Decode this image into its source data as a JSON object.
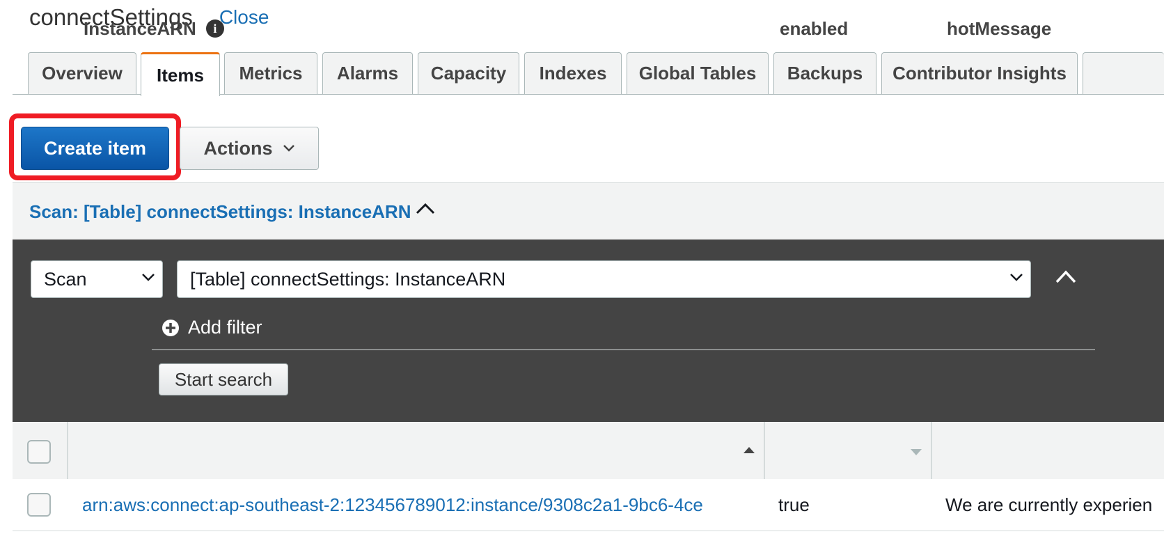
{
  "header": {
    "title": "connectSettings",
    "close_label": "Close"
  },
  "tabs": [
    {
      "label": "Overview",
      "active": false
    },
    {
      "label": "Items",
      "active": true
    },
    {
      "label": "Metrics",
      "active": false
    },
    {
      "label": "Alarms",
      "active": false
    },
    {
      "label": "Capacity",
      "active": false
    },
    {
      "label": "Indexes",
      "active": false
    },
    {
      "label": "Global Tables",
      "active": false
    },
    {
      "label": "Backups",
      "active": false
    },
    {
      "label": "Contributor Insights",
      "active": false
    }
  ],
  "toolbar": {
    "create_label": "Create item",
    "actions_label": "Actions"
  },
  "scan": {
    "title": "Scan: [Table] connectSettings: InstanceARN",
    "mode_value": "Scan",
    "target_value": "[Table] connectSettings: InstanceARN",
    "add_filter_label": "Add filter",
    "start_search_label": "Start search"
  },
  "table": {
    "columns": [
      "InstanceARN",
      "enabled",
      "hotMessage"
    ],
    "rows": [
      {
        "instance_arn": "arn:aws:connect:ap-southeast-2:123456789012:instance/9308c2a1-9bc6-4ce",
        "enabled": "true",
        "hot_message": "We are currently experien"
      }
    ]
  },
  "colors": {
    "accent": "#1a6fb4",
    "primary_button": "#0a55a6",
    "active_tab": "#ec7211",
    "highlight": "#ef1c24",
    "panel": "#444444"
  }
}
